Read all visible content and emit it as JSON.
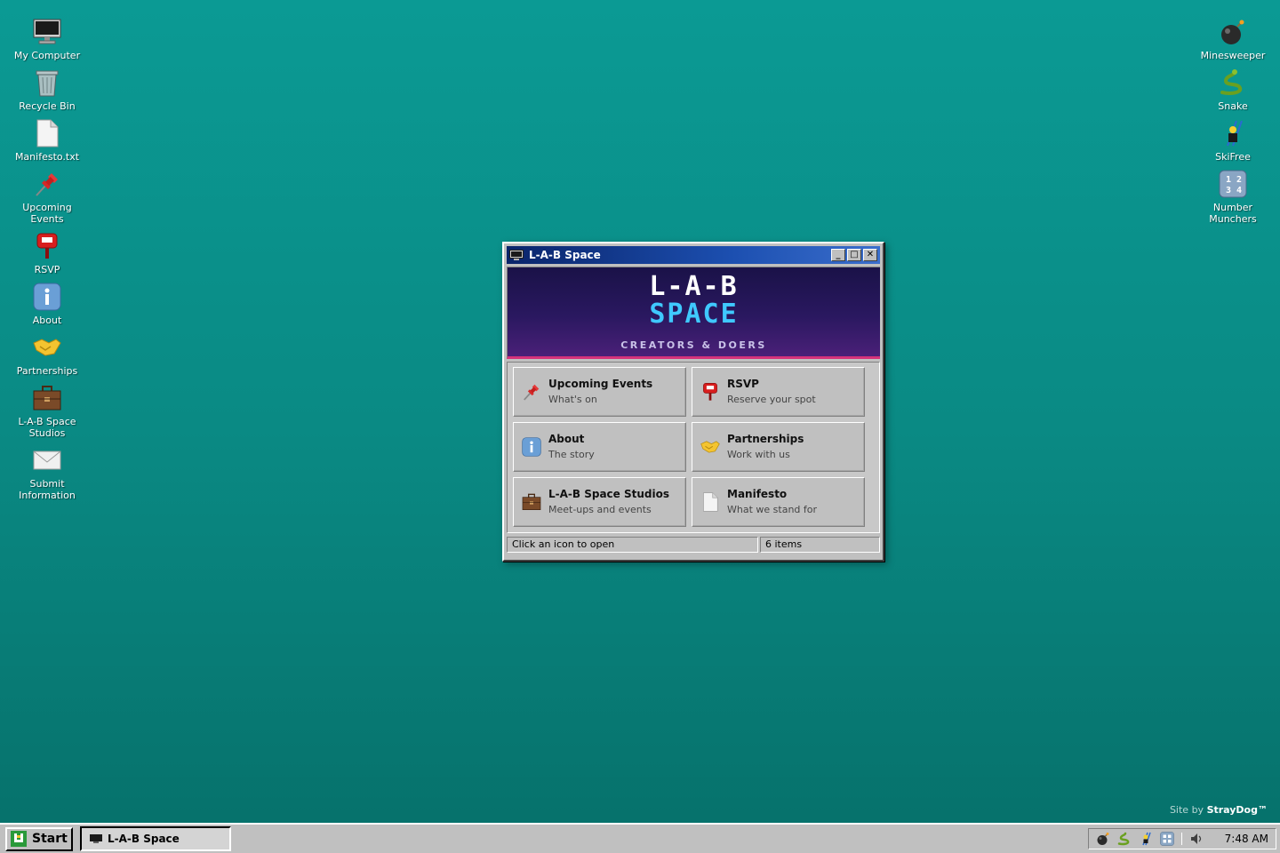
{
  "desktop": {
    "left_icons": [
      {
        "label": "My Computer",
        "icon": "computer-icon"
      },
      {
        "label": "Recycle Bin",
        "icon": "recycle-bin-icon"
      },
      {
        "label": "Manifesto.txt",
        "icon": "text-file-icon"
      },
      {
        "label": "Upcoming Events",
        "icon": "pushpin-icon"
      },
      {
        "label": "RSVP",
        "icon": "mailbox-icon"
      },
      {
        "label": "About",
        "icon": "info-icon"
      },
      {
        "label": "Partnerships",
        "icon": "handshake-icon"
      },
      {
        "label": "L-A-B Space Studios",
        "icon": "briefcase-icon"
      },
      {
        "label": "Submit Information",
        "icon": "envelope-icon"
      }
    ],
    "right_icons": [
      {
        "label": "Minesweeper",
        "icon": "bomb-icon"
      },
      {
        "label": "Snake",
        "icon": "snake-icon"
      },
      {
        "label": "SkiFree",
        "icon": "skier-icon"
      },
      {
        "label": "Number Munchers",
        "icon": "number-grid-icon"
      }
    ]
  },
  "window": {
    "title": "L-A-B Space",
    "buttons": {
      "minimize": "_",
      "maximize": "□",
      "close": "✕"
    },
    "banner": {
      "line1": "L-A-B",
      "line2": "SPACE",
      "tagline": "CREATORS & DOERS"
    },
    "tiles": [
      {
        "title": "Upcoming Events",
        "subtitle": "What's on",
        "icon": "pushpin-icon"
      },
      {
        "title": "RSVP",
        "subtitle": "Reserve your spot",
        "icon": "mailbox-icon"
      },
      {
        "title": "About",
        "subtitle": "The story",
        "icon": "info-icon"
      },
      {
        "title": "Partnerships",
        "subtitle": "Work with us",
        "icon": "handshake-icon"
      },
      {
        "title": "L-A-B Space Studios",
        "subtitle": "Meet-ups and events",
        "icon": "briefcase-icon"
      },
      {
        "title": "Manifesto",
        "subtitle": "What we stand for",
        "icon": "document-icon"
      }
    ],
    "status": {
      "hint": "Click an icon to open",
      "count": "6 items"
    }
  },
  "credit": {
    "prefix": "Site by",
    "brand": "StrayDog™"
  },
  "taskbar": {
    "start_label": "Start",
    "task_label": "L-A-B Space",
    "tray_icons": [
      "bomb-icon",
      "snake-icon",
      "skier-icon",
      "number-grid-icon",
      "speaker-icon"
    ],
    "clock": "7:48 AM"
  },
  "colors": {
    "desktop": "#0a8a84",
    "titlebar": "#0a246a",
    "banner": "#2a1860",
    "banner_accent": "#d6337a",
    "logo_cyan": "#3fc9ff"
  }
}
